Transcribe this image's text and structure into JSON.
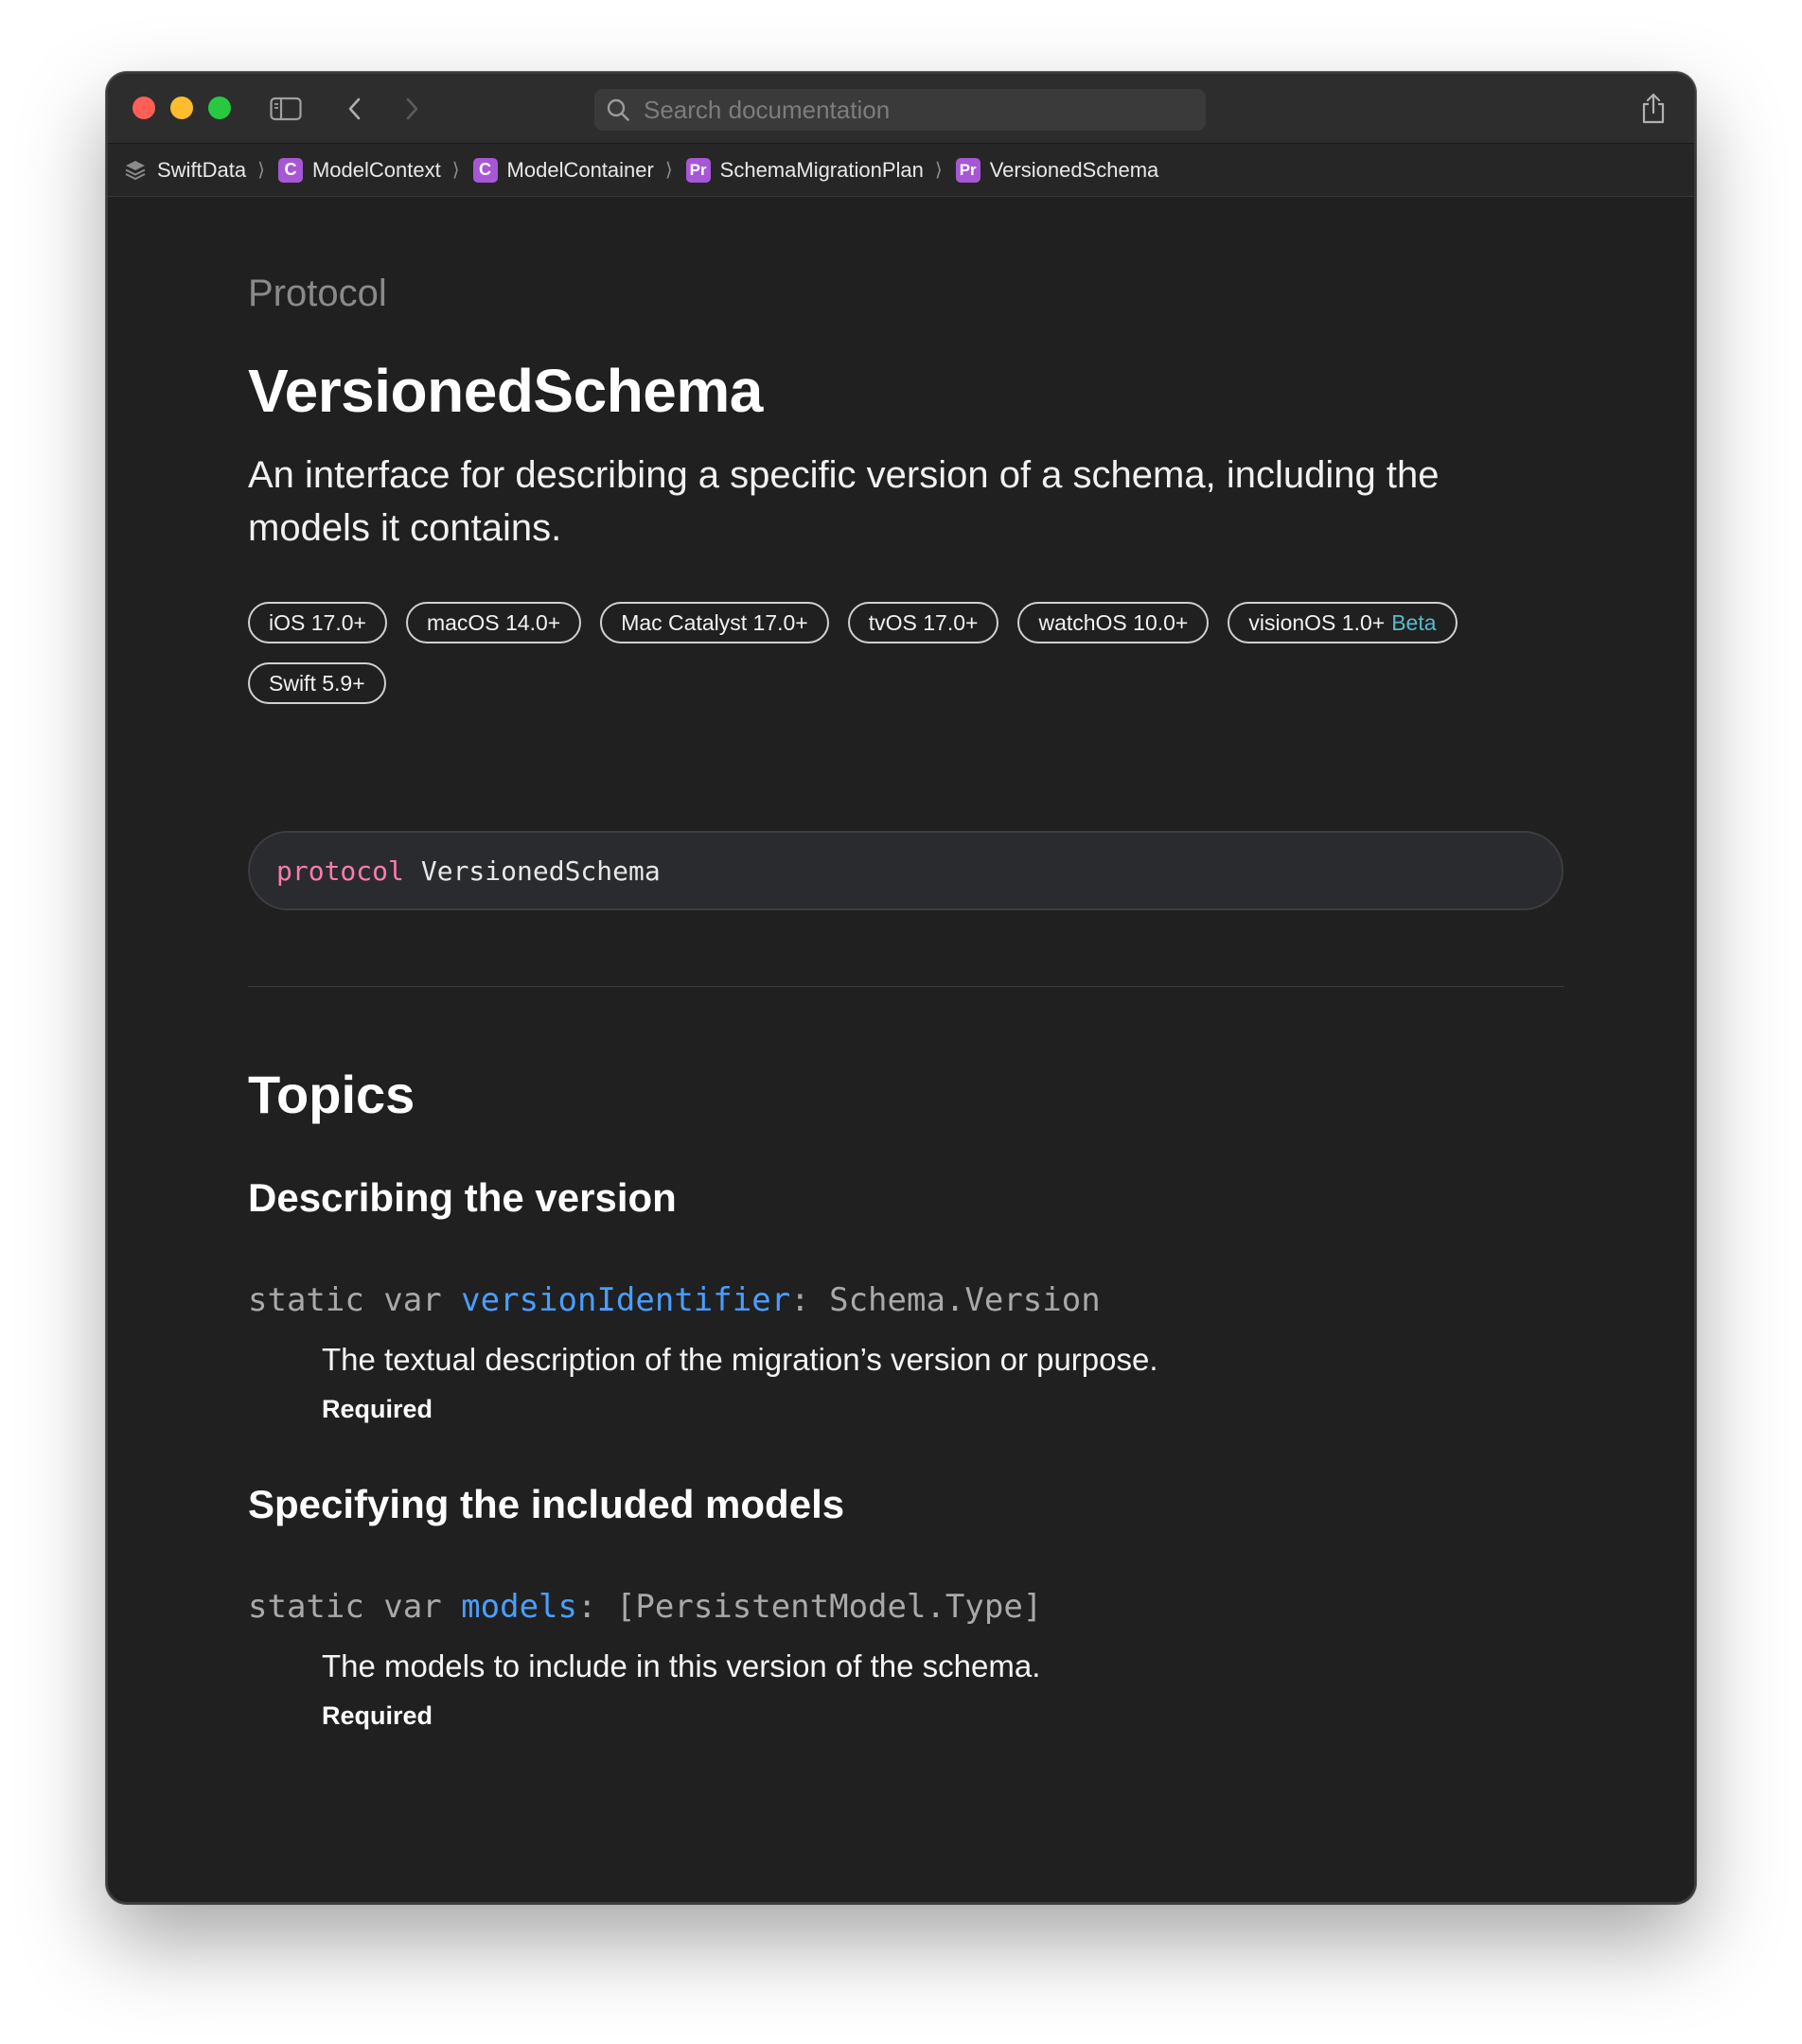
{
  "toolbar": {
    "search_placeholder": "Search documentation"
  },
  "breadcrumbs": [
    {
      "label": "SwiftData",
      "badge": ""
    },
    {
      "label": "ModelContext",
      "badge": "C"
    },
    {
      "label": "ModelContainer",
      "badge": "C"
    },
    {
      "label": "SchemaMigrationPlan",
      "badge": "Pr"
    },
    {
      "label": "VersionedSchema",
      "badge": "Pr"
    }
  ],
  "breadcrumb_separator": "⟩",
  "page": {
    "kind": "Protocol",
    "title": "VersionedSchema",
    "abstract": "An interface for describing a specific version of a schema, including the models it contains."
  },
  "availability": [
    {
      "label": "iOS 17.0+",
      "beta": ""
    },
    {
      "label": "macOS 14.0+",
      "beta": ""
    },
    {
      "label": "Mac Catalyst 17.0+",
      "beta": ""
    },
    {
      "label": "tvOS 17.0+",
      "beta": ""
    },
    {
      "label": "watchOS 10.0+",
      "beta": ""
    },
    {
      "label": "visionOS 1.0+",
      "beta": "Beta"
    },
    {
      "label": "Swift 5.9+",
      "beta": ""
    }
  ],
  "declaration": {
    "keyword": "protocol",
    "name": "VersionedSchema"
  },
  "topics": {
    "heading": "Topics",
    "groups": [
      {
        "heading": "Describing the version",
        "sig_prefix": "static var ",
        "sig_name": "versionIdentifier",
        "sig_suffix": ": Schema.Version",
        "description": "The textual description of the migration’s version or purpose.",
        "required": "Required"
      },
      {
        "heading": "Specifying the included models",
        "sig_prefix": "static var ",
        "sig_name": "models",
        "sig_suffix": ": [PersistentModel.Type]",
        "description": "The models to include in this version of the schema.",
        "required": "Required"
      }
    ]
  },
  "colors": {
    "window_bg": "#202020",
    "keyword": "#ff7ab2",
    "symbol_link": "#4a9eff",
    "beta": "#55bcc9",
    "badge_purple": "#a757d5"
  }
}
